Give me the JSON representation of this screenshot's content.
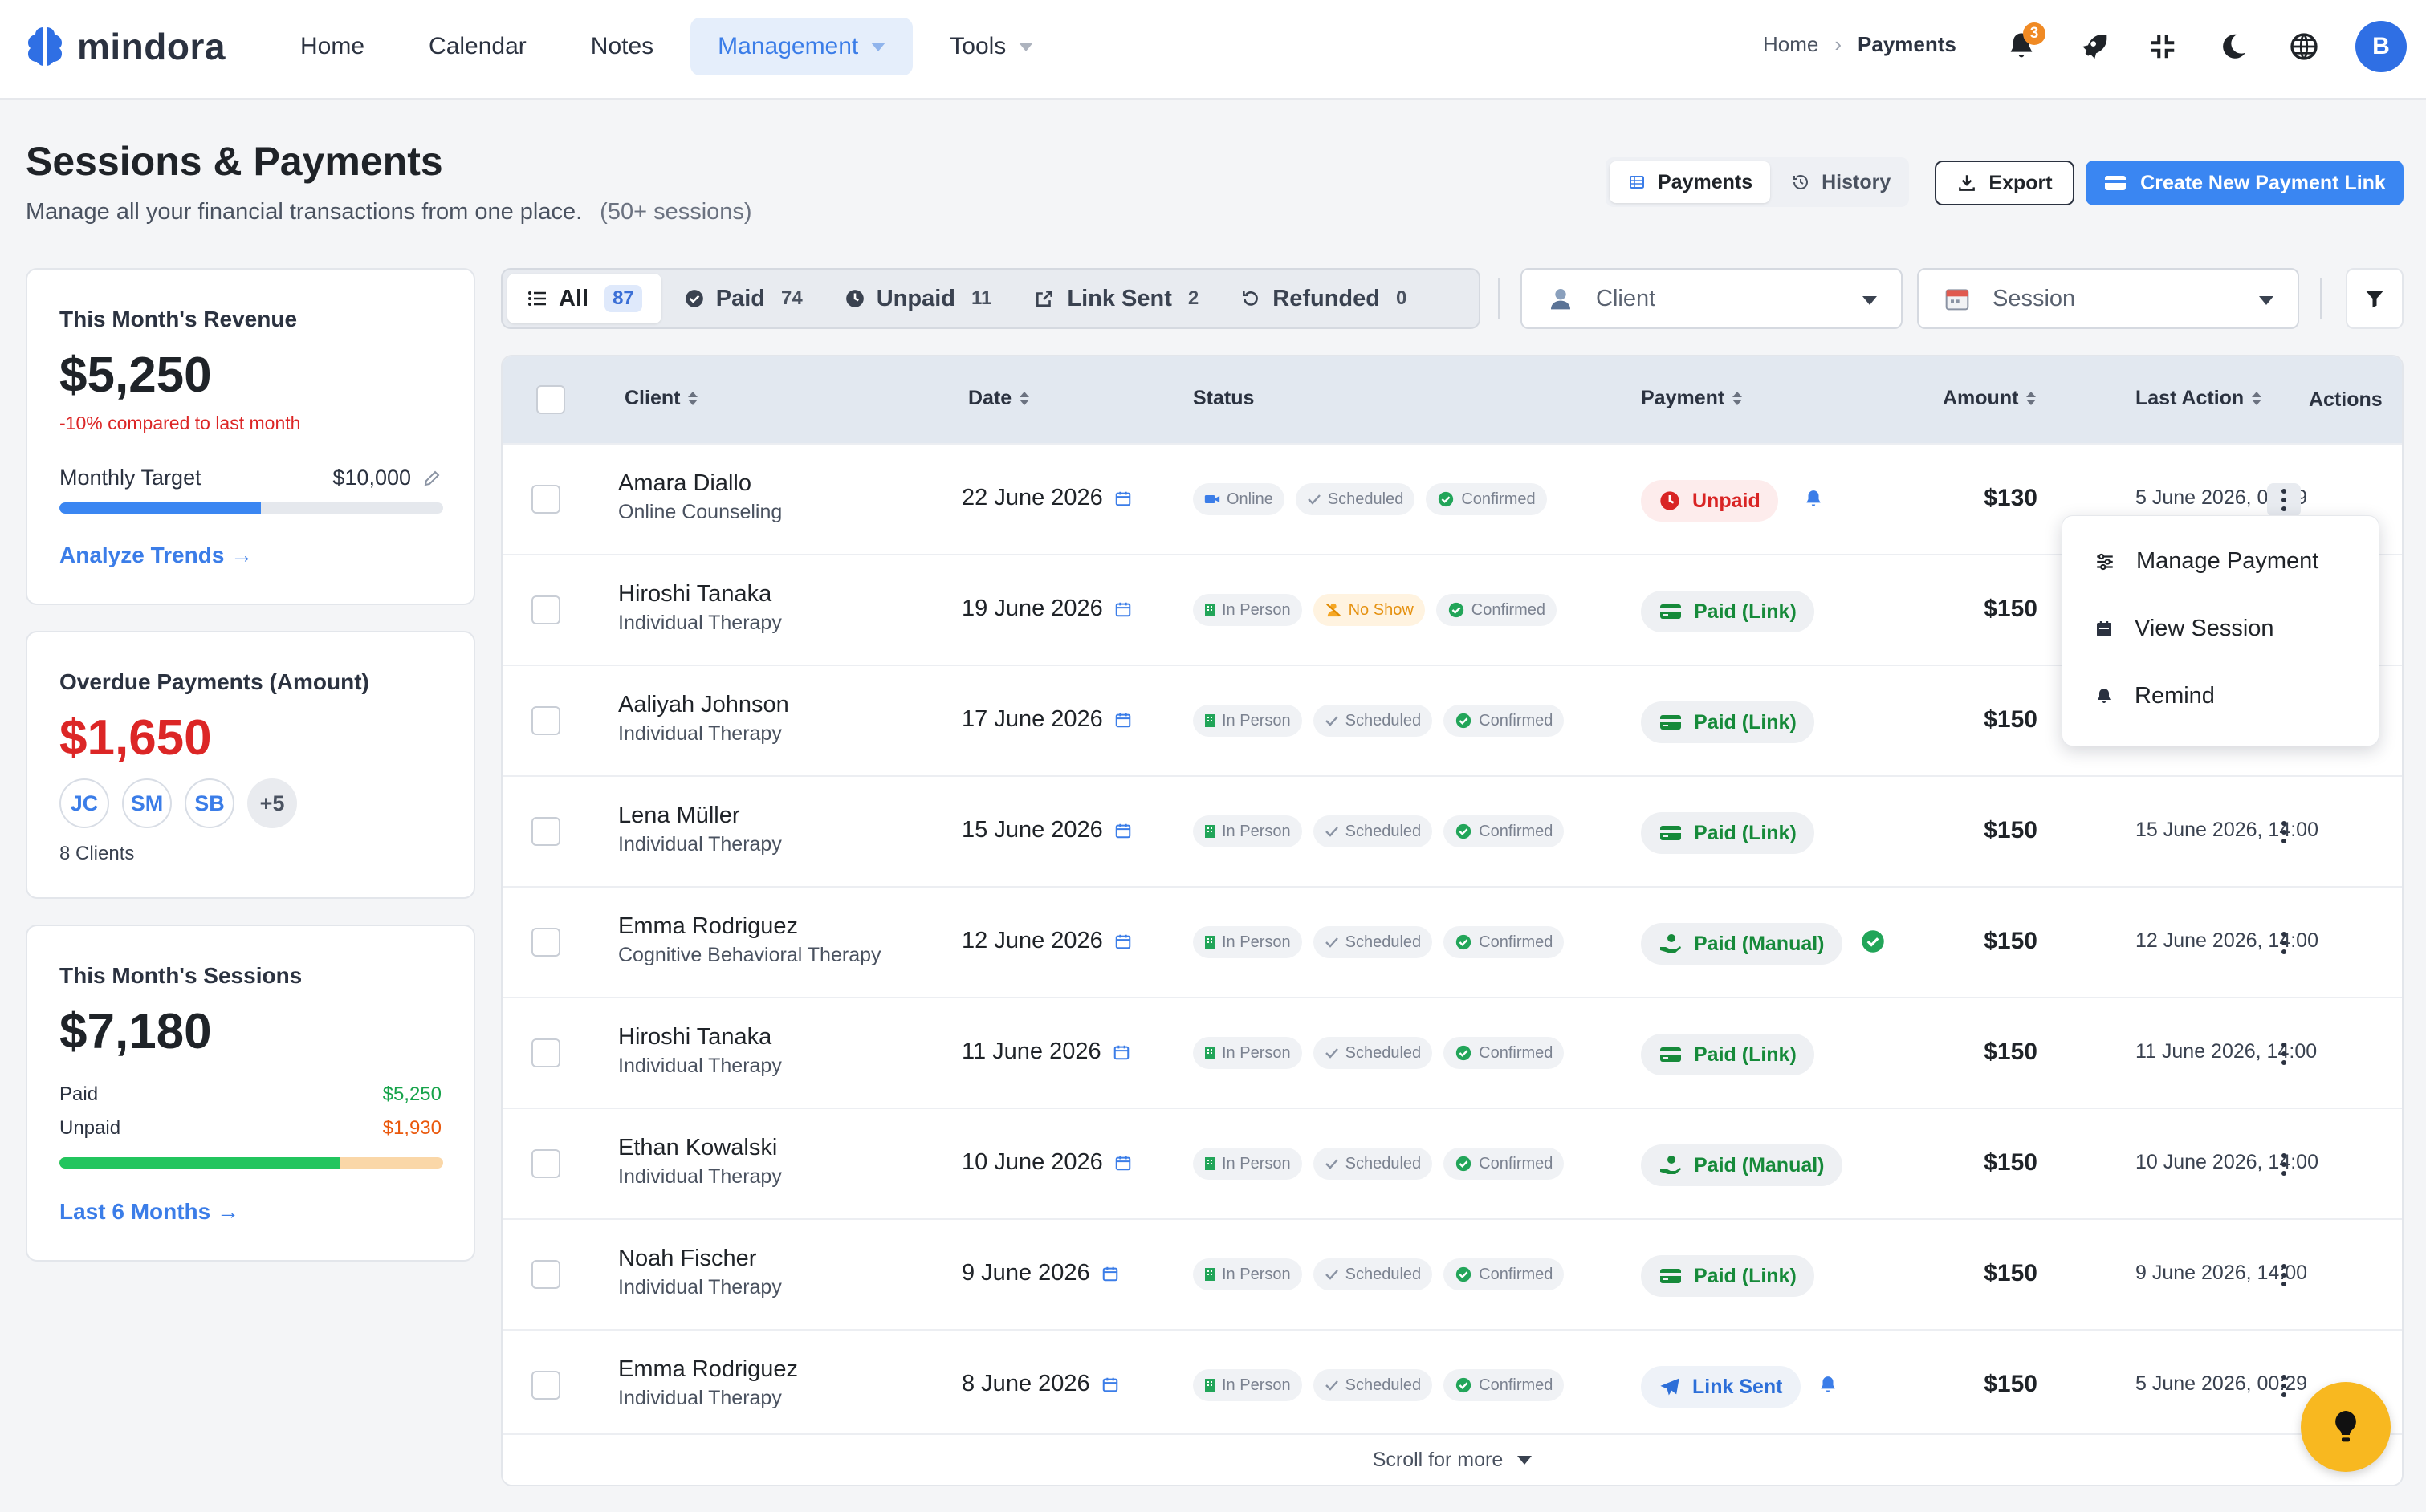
{
  "brand": {
    "name": "mindora",
    "accent": "#3a86f2"
  },
  "nav": [
    {
      "label": "Home"
    },
    {
      "label": "Calendar"
    },
    {
      "label": "Notes"
    },
    {
      "label": "Management",
      "active": true
    },
    {
      "label": "Tools"
    }
  ],
  "breadcrumb": {
    "home": "Home",
    "current": "Payments"
  },
  "header_icons": {
    "notifications_count": "3",
    "avatar_initial": "B"
  },
  "page": {
    "title": "Sessions & Payments",
    "subtitle": "Manage all your financial transactions from one place.",
    "count_note": "(50+ sessions)"
  },
  "view_toggle": {
    "payments": "Payments",
    "history": "History"
  },
  "actions": {
    "export": "Export",
    "create": "Create New Payment Link"
  },
  "cards": {
    "revenue": {
      "title": "This Month's Revenue",
      "value": "$5,250",
      "delta": "-10% compared to last month",
      "target_label": "Monthly Target",
      "target_value": "$10,000",
      "progress": 0.525,
      "link": "Analyze Trends →"
    },
    "overdue": {
      "title": "Overdue Payments (Amount)",
      "value": "$1,650",
      "avatars": [
        "JC",
        "SM",
        "SB"
      ],
      "more": "+5",
      "clients": "8 Clients"
    },
    "sessions": {
      "title": "This Month's Sessions",
      "value": "$7,180",
      "paid_label": "Paid",
      "paid_value": "$5,250",
      "unpaid_label": "Unpaid",
      "unpaid_value": "$1,930",
      "paid_fraction": 0.731,
      "link": "Last 6 Months →"
    }
  },
  "filters": {
    "tabs": [
      {
        "label": "All",
        "count": "87",
        "active": true
      },
      {
        "label": "Paid",
        "count": "74"
      },
      {
        "label": "Unpaid",
        "count": "11"
      },
      {
        "label": "Link Sent",
        "count": "2"
      },
      {
        "label": "Refunded",
        "count": "0"
      }
    ],
    "client_placeholder": "Client",
    "session_placeholder": "Session"
  },
  "table": {
    "columns": {
      "client": "Client",
      "date": "Date",
      "status": "Status",
      "payment": "Payment",
      "amount": "Amount",
      "last_action": "Last Action",
      "actions": "Actions"
    },
    "rows": [
      {
        "name": "Amara Diallo",
        "type": "Online Counseling",
        "date": "22 June 2026",
        "mode": "Online",
        "state": "Scheduled",
        "confirm": "Confirmed",
        "payment": "Unpaid",
        "pay_kind": "unpaid",
        "amount": "$130",
        "last_action": "5 June 2026, 00:29"
      },
      {
        "name": "Hiroshi Tanaka",
        "type": "Individual Therapy",
        "date": "19 June 2026",
        "mode": "In Person",
        "state": "No Show",
        "confirm": "Confirmed",
        "payment": "Paid (Link)",
        "pay_kind": "link",
        "amount": "$150",
        "last_action": ""
      },
      {
        "name": "Aaliyah Johnson",
        "type": "Individual Therapy",
        "date": "17 June 2026",
        "mode": "In Person",
        "state": "Scheduled",
        "confirm": "Confirmed",
        "payment": "Paid (Link)",
        "pay_kind": "link",
        "amount": "$150",
        "last_action": ""
      },
      {
        "name": "Lena Müller",
        "type": "Individual Therapy",
        "date": "15 June 2026",
        "mode": "In Person",
        "state": "Scheduled",
        "confirm": "Confirmed",
        "payment": "Paid (Link)",
        "pay_kind": "link",
        "amount": "$150",
        "last_action": "15 June 2026, 14:00"
      },
      {
        "name": "Emma Rodriguez",
        "type": "Cognitive Behavioral Therapy",
        "date": "12 June 2026",
        "mode": "In Person",
        "state": "Scheduled",
        "confirm": "Confirmed",
        "payment": "Paid (Manual)",
        "pay_kind": "manual",
        "amount": "$150",
        "last_action": "12 June 2026, 14:00"
      },
      {
        "name": "Hiroshi Tanaka",
        "type": "Individual Therapy",
        "date": "11 June 2026",
        "mode": "In Person",
        "state": "Scheduled",
        "confirm": "Confirmed",
        "payment": "Paid (Link)",
        "pay_kind": "link",
        "amount": "$150",
        "last_action": "11 June 2026, 14:00"
      },
      {
        "name": "Ethan Kowalski",
        "type": "Individual Therapy",
        "date": "10 June 2026",
        "mode": "In Person",
        "state": "Scheduled",
        "confirm": "Confirmed",
        "payment": "Paid (Manual)",
        "pay_kind": "manual",
        "amount": "$150",
        "last_action": "10 June 2026, 14:00"
      },
      {
        "name": "Noah Fischer",
        "type": "Individual Therapy",
        "date": "9 June 2026",
        "mode": "In Person",
        "state": "Scheduled",
        "confirm": "Confirmed",
        "payment": "Paid (Link)",
        "pay_kind": "link",
        "amount": "$150",
        "last_action": "9 June 2026, 14:00"
      },
      {
        "name": "Emma Rodriguez",
        "type": "Individual Therapy",
        "date": "8 June 2026",
        "mode": "In Person",
        "state": "Scheduled",
        "confirm": "Confirmed",
        "payment": "Link Sent",
        "pay_kind": "sent",
        "amount": "$150",
        "last_action": "5 June 2026, 00:29"
      }
    ],
    "scroll_more": "Scroll for more"
  },
  "row_menu": {
    "manage": "Manage Payment",
    "view": "View Session",
    "remind": "Remind"
  }
}
